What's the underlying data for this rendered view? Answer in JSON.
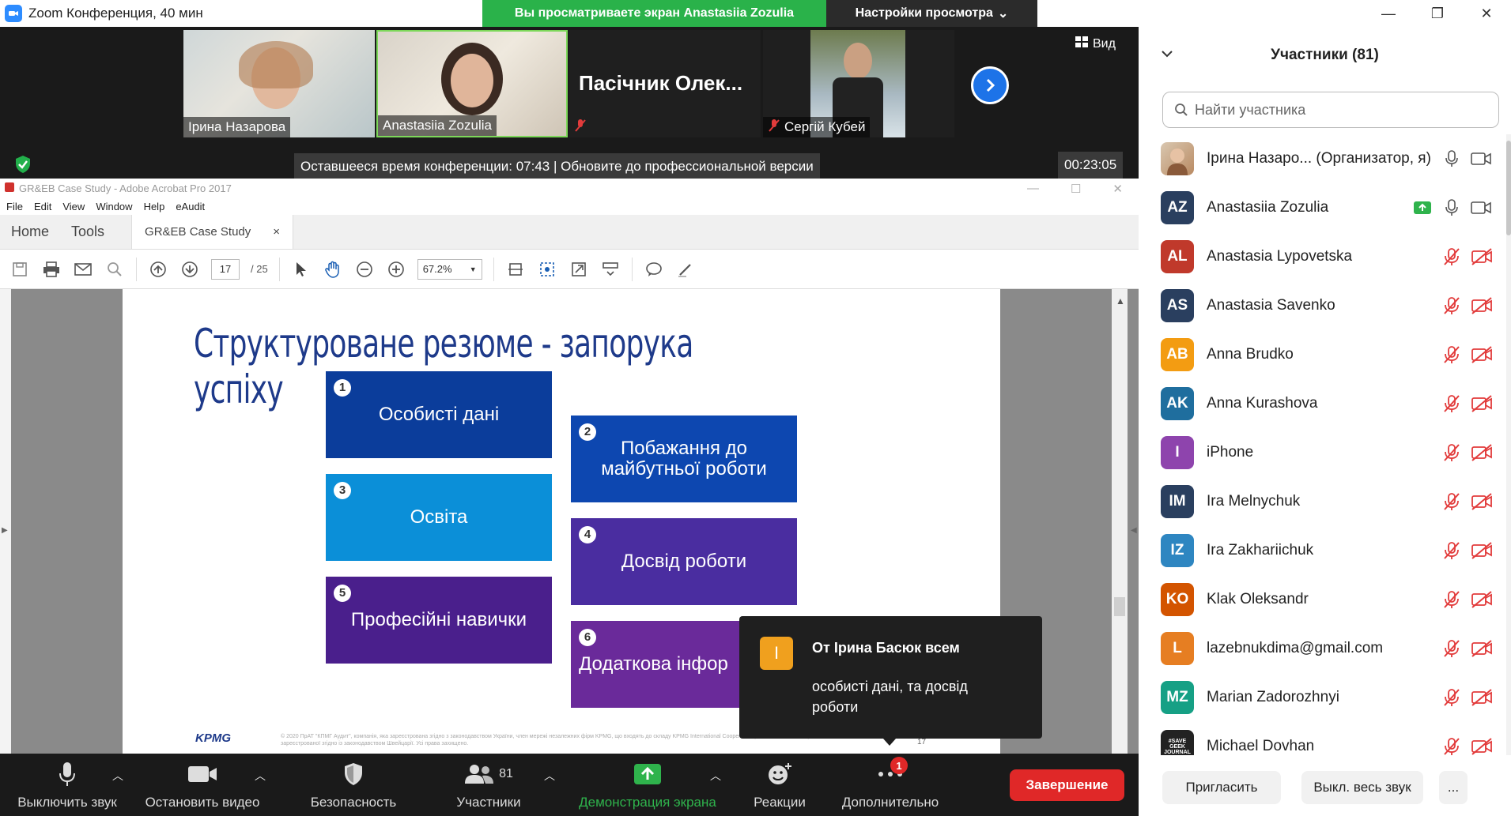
{
  "window": {
    "title": "Zoom Конференция, 40 мин"
  },
  "banner": {
    "viewing": "Вы просматриваете экран Anastasiia Zozulia",
    "view_settings": "Настройки просмотра"
  },
  "videos": [
    {
      "name": "Ірина Назарова"
    },
    {
      "name": "Anastasiia Zozulia"
    },
    {
      "name": "Пасічник Олек..."
    },
    {
      "name": "Сергій Кубей"
    }
  ],
  "view_label": "Вид",
  "remaining_time": "Оставшееся время конференции: 07:43 | Обновите до профессиональной версии",
  "timer": "00:23:05",
  "acrobat": {
    "title": "GR&EB Case Study - Adobe Acrobat Pro 2017",
    "menu": [
      "File",
      "Edit",
      "View",
      "Window",
      "Help",
      "eAudit"
    ],
    "tabs": {
      "home": "Home",
      "tools": "Tools",
      "doc": "GR&EB Case Study"
    },
    "page_current": "17",
    "page_total": "/ 25",
    "zoom": "67.2%"
  },
  "slide": {
    "title": "Структуроване резюме - запорука успіху",
    "boxes": [
      {
        "num": "1",
        "text": "Особисті дані",
        "color": "#0b3d9b"
      },
      {
        "num": "2",
        "text": "Побажання до майбутньої роботи",
        "color": "#0d47b0"
      },
      {
        "num": "3",
        "text": "Освіта",
        "color": "#0b8fd8"
      },
      {
        "num": "4",
        "text": "Досвід роботи",
        "color": "#4a2da0"
      },
      {
        "num": "5",
        "text": "Професійні навички",
        "color": "#4a1f8c"
      },
      {
        "num": "6",
        "text": "Додаткова інфор",
        "color": "#6a2a9a"
      }
    ],
    "footer": "© 2020 ПрАТ \"КПМГ Аудит\", компанія, яка зареєстрована згідно з законодавством України, член мережі незалежних фірм KPMG, що входять до складу KPMG International Cooperative (\"KPMG International\"), зареєстрованої згідно із законодавством Швейцарії. Усі права захищено.",
    "logo": "KPMG",
    "page": "17"
  },
  "chat": {
    "avatar": "I",
    "from": "От Ірина Басюк всем",
    "message": "особисті дані, та досвід роботи"
  },
  "toolbar": {
    "mute": "Выключить звук",
    "video": "Остановить видео",
    "security": "Безопасность",
    "participants": "Участники",
    "participants_count": "81",
    "share": "Демонстрация экрана",
    "reactions": "Реакции",
    "more": "Дополнительно",
    "more_badge": "1",
    "end": "Завершение"
  },
  "panel": {
    "title": "Участники (81)",
    "search_placeholder": "Найти участника",
    "participants": [
      {
        "initials": "",
        "name": "Ірина Назаро... (Организатор, я)",
        "color": "#c9a27a",
        "muted": false,
        "video": true,
        "share": false
      },
      {
        "initials": "AZ",
        "name": "Anastasiia Zozulia",
        "color": "#2a3f5f",
        "muted": false,
        "video": true,
        "share": true
      },
      {
        "initials": "AL",
        "name": "Anastasia Lypovetska",
        "color": "#c0392b",
        "muted": true,
        "video": false,
        "share": false
      },
      {
        "initials": "AS",
        "name": "Anastasia Savenko",
        "color": "#2a3f5f",
        "muted": true,
        "video": false,
        "share": false
      },
      {
        "initials": "AB",
        "name": "Anna Brudko",
        "color": "#f39c12",
        "muted": true,
        "video": false,
        "share": false
      },
      {
        "initials": "AK",
        "name": "Anna Kurashova",
        "color": "#1f6e9e",
        "muted": true,
        "video": false,
        "share": false
      },
      {
        "initials": "I",
        "name": "iPhone",
        "color": "#8e44ad",
        "muted": true,
        "video": false,
        "share": false
      },
      {
        "initials": "IM",
        "name": "Ira Melnychuk",
        "color": "#2a3f5f",
        "muted": true,
        "video": false,
        "share": false
      },
      {
        "initials": "IZ",
        "name": "Ira Zakhariichuk",
        "color": "#2e86c1",
        "muted": true,
        "video": false,
        "share": false
      },
      {
        "initials": "KO",
        "name": "Klak Oleksandr",
        "color": "#d35400",
        "muted": true,
        "video": false,
        "share": false
      },
      {
        "initials": "L",
        "name": "lazebnukdima@gmail.com",
        "color": "#e67e22",
        "muted": true,
        "video": false,
        "share": false
      },
      {
        "initials": "MZ",
        "name": "Marian Zadorozhnyi",
        "color": "#16a085",
        "muted": true,
        "video": false,
        "share": false
      },
      {
        "initials": "#SAVE GEEK JOURNAL",
        "name": "Michael Dovhan",
        "color": "#222222",
        "muted": true,
        "video": false,
        "share": false
      }
    ],
    "invite": "Пригласить",
    "mute_all": "Выкл. весь звук",
    "more": "..."
  }
}
